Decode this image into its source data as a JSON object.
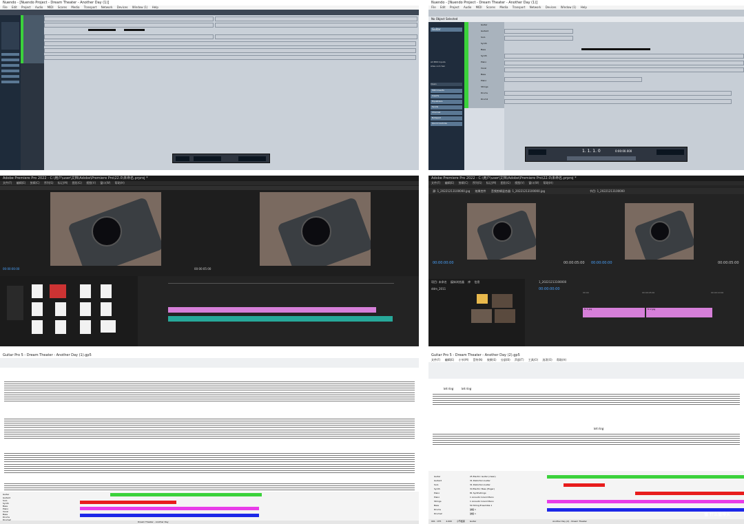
{
  "colors": {
    "accent_green": "#3bd23b",
    "accent_red": "#e81c1c",
    "accent_magenta": "#e83ce8",
    "accent_blue": "#1c28e8",
    "accent_yellow": "#f0e020",
    "premiere_pink": "#d67fd9",
    "premiere_teal": "#27a89a"
  },
  "nuendo_a": {
    "title": "Nuendo - [Nuendo Project - Dream Theater - Another Day (1)]",
    "menu": [
      "File",
      "Edit",
      "Project",
      "Audio",
      "MIDI",
      "Scores",
      "Media",
      "Transport",
      "Network",
      "Devices",
      "Window (1)",
      "Help"
    ]
  },
  "nuendo_b": {
    "title": "Nuendo - [Nuendo Project - Dream Theater - Another Day (1)]",
    "menu": [
      "File",
      "Edit",
      "Project",
      "Audio",
      "MIDI",
      "Scores",
      "Media",
      "Transport",
      "Network",
      "Devices",
      "Window (1)",
      "Help"
    ],
    "no_object": "No Object Selected",
    "inspector_title": "Guitar",
    "inspector_items": [
      "All MIDI Inputs",
      "Alles vom Sen",
      "Clean",
      "MIDI Inserts",
      "Inserts",
      "Equalizers",
      "Sends",
      "Channel",
      "Notepad",
      "Quick Controls"
    ],
    "tracks": [
      "Guitar",
      "Guitar2",
      "Solo",
      "Synth",
      "Bass",
      "Synth",
      "Piano",
      "Vocal",
      "Bass",
      "Piano",
      "Strings",
      "Drums",
      "Drum2"
    ],
    "transport_pos": "1. 1. 1. 0",
    "transport_time": "0:00:00.000"
  },
  "premiere_a": {
    "title": "Adobe Premiere Pro 2022 - C:\\用户\\user\\文档\\Adobe\\Premiere Pro\\22.0\\未命名.prproj *",
    "menu": [
      "文件(F)",
      "编辑(E)",
      "剪辑(C)",
      "序列(S)",
      "标记(M)",
      "图形(G)",
      "视图(V)",
      "窗口(W)",
      "帮助(H)"
    ],
    "program_time": "00:00:00:00",
    "source_time": "00:00:05:00"
  },
  "premiere_b": {
    "title": "Adobe Premiere Pro 2022 - C:\\用户\\user\\文档\\Adobe\\Premiere Pro\\22.0\\未命名.prproj *",
    "menu": [
      "文件(F)",
      "编辑(E)",
      "剪辑(C)",
      "序列(S)",
      "标记(M)",
      "图形(G)",
      "视图(V)",
      "窗口(W)",
      "帮助(H)"
    ],
    "tabs": [
      "源: 1_20221213100000.jpg",
      "效果控件",
      "音频剪辑混合器: 1_20221213100000.jpg"
    ],
    "program_tab": "节目: 1_20221213100000",
    "source_time": "00:00:00:00",
    "program_time": "00:00:00:00",
    "duration": "00:00:05:00",
    "fit": "适合",
    "ratio": "1/2",
    "project_tabs": [
      "项目: 未命名",
      "媒体浏览器",
      "库",
      "信息"
    ],
    "folder_name": "ddm_2011",
    "seq_name": "1_20221213100000",
    "seq_time": "00:00:00:00",
    "timeline_ticks": [
      "00:00",
      "00:00:05:00",
      "00:00:10:00"
    ],
    "clip_a": "fx 1.jpg",
    "clip_b": "fx 2.jpg"
  },
  "guitarpro_a": {
    "title": "Guitar Pro 5 - Dream Theater - Another Day (1).gp5",
    "tracks": [
      "Guitar",
      "Guitar2",
      "Solo",
      "Synth",
      "Bass",
      "Piano",
      "Vocal",
      "Bass",
      "Drums",
      "Drums2"
    ],
    "status": "Dream Theater - Another Day"
  },
  "guitarpro_b": {
    "title": "Guitar Pro 5 - Dream Theater - Another Day (2).gp5",
    "menu": [
      "文件(F)",
      "编辑(E)",
      "小节(M)",
      "音符(N)",
      "效果(E)",
      "分部(B)",
      "声部(T)",
      "工具(O)",
      "选项(O)",
      "帮助(H)"
    ],
    "let_ring": "let ring",
    "track_names": [
      "Guitar",
      "Guitar2",
      "Solo",
      "Synth",
      "Piano",
      "Piano",
      "Strings",
      "Bass",
      "Drums",
      "Drums2"
    ],
    "instruments": [
      "25 Electric Guitar (clean)",
      "31 Distortion Guitar",
      "31 Distortion Guitar",
      "34 Electric Bass (finger)",
      "81 Synthstrings",
      "1 Acoustic Grand Piano",
      "1 Acoustic Grand Piano",
      "50 String Ensemble 1",
      "鼓组 1",
      "鼓组 1"
    ],
    "status_left": "001 : 075",
    "status_mid": "4.000",
    "status_right": "Another Day (2) - Dream Theater",
    "status_label": "小节结束",
    "status_track": "Guitar",
    "watermark": "值 什么值得买"
  }
}
